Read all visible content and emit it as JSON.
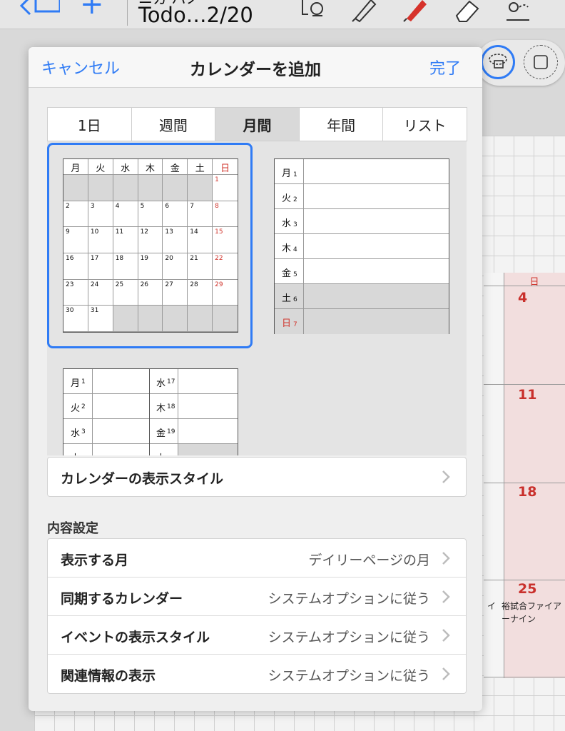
{
  "toolbar": {
    "title_top": "ニカ ハノ",
    "title": "Todo…2/20"
  },
  "background_calendar": {
    "day_header": "日",
    "dates": [
      "4",
      "11",
      "18",
      "25"
    ],
    "event_left": "イ",
    "event_line1": "裕試合ファイア",
    "event_line2": "ーナイン"
  },
  "popover": {
    "cancel": "キャンセル",
    "title": "カレンダーを追加",
    "done": "完了",
    "tabs": [
      "1日",
      "週間",
      "月間",
      "年間",
      "リスト"
    ],
    "active_tab": "月間",
    "month_grid": {
      "headers": [
        "月",
        "火",
        "水",
        "木",
        "金",
        "土",
        "日"
      ],
      "weeks": [
        [
          "",
          "",
          "",
          "",
          "",
          "",
          "1"
        ],
        [
          "2",
          "3",
          "4",
          "5",
          "6",
          "7",
          "8"
        ],
        [
          "9",
          "10",
          "11",
          "12",
          "13",
          "14",
          "15"
        ],
        [
          "16",
          "17",
          "18",
          "19",
          "20",
          "21",
          "22"
        ],
        [
          "23",
          "24",
          "25",
          "26",
          "27",
          "28",
          "29"
        ],
        [
          "30",
          "31",
          "",
          "",
          "",
          "",
          ""
        ]
      ]
    },
    "week_list": {
      "days": [
        {
          "label": "月",
          "num": "1"
        },
        {
          "label": "火",
          "num": "2"
        },
        {
          "label": "水",
          "num": "3"
        },
        {
          "label": "木",
          "num": "4"
        },
        {
          "label": "金",
          "num": "5"
        },
        {
          "label": "土",
          "num": "6"
        },
        {
          "label": "日",
          "num": "7"
        }
      ]
    },
    "two_column": {
      "left": [
        {
          "label": "月",
          "num": "1"
        },
        {
          "label": "火",
          "num": "2"
        },
        {
          "label": "水",
          "num": "3"
        },
        {
          "label": "土",
          "num": ""
        }
      ],
      "right": [
        {
          "label": "水",
          "num": "17"
        },
        {
          "label": "木",
          "num": "18"
        },
        {
          "label": "金",
          "num": "19"
        },
        {
          "label": "土",
          "num": ""
        }
      ]
    },
    "display_style_label": "カレンダーの表示スタイル",
    "section_title": "内容設定",
    "settings": [
      {
        "label": "表示する月",
        "value": "デイリーページの月"
      },
      {
        "label": "同期するカレンダー",
        "value": "システムオプションに従う"
      },
      {
        "label": "イベントの表示スタイル",
        "value": "システムオプションに従う"
      },
      {
        "label": "関連情報の表示",
        "value": "システムオプションに従う"
      }
    ]
  },
  "colors": {
    "accent": "#2f7bf5",
    "sunday_red": "#d0342c",
    "calendar_pink": "#f2dede"
  }
}
